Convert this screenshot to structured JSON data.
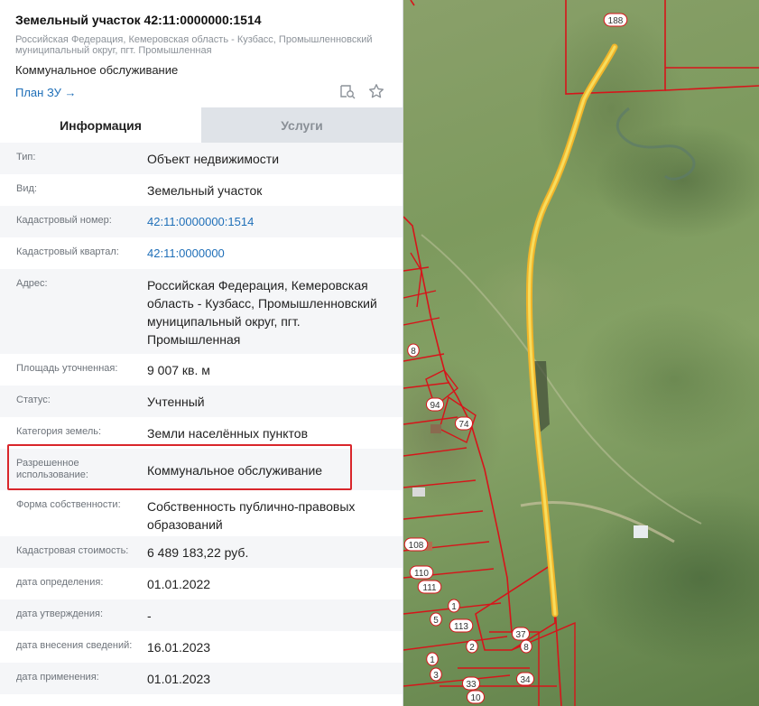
{
  "header": {
    "title": "Земельный участок 42:11:0000000:1514",
    "address_line": "Российская Федерация, Кемеровская область - Кузбасс, Промышленновский муниципальный округ, пгт. Промышленная",
    "purpose": "Коммунальное обслуживание",
    "plan_link": "План ЗУ →"
  },
  "icons": [
    "search-doc-icon",
    "star-icon"
  ],
  "tabs": [
    {
      "label": "Информация",
      "active": true
    },
    {
      "label": "Услуги",
      "active": false
    }
  ],
  "rows": [
    {
      "label": "Тип:",
      "value": "Объект недвижимости"
    },
    {
      "label": "Вид:",
      "value": "Земельный участок"
    },
    {
      "label": "Кадастровый номер:",
      "value": "42:11:0000000:1514"
    },
    {
      "label": "Кадастровый квартал:",
      "value": "42:11:0000000"
    },
    {
      "label": "Адрес:",
      "value": "Российская Федерация, Кемеровская область - Кузбасс, Промышленновский муниципальный округ, пгт. Промышленная"
    },
    {
      "label": "Площадь уточненная:",
      "value": "9 007 кв. м"
    },
    {
      "label": "Статус:",
      "value": "Учтенный"
    },
    {
      "label": "Категория земель:",
      "value": "Земли населённых пунктов"
    },
    {
      "label": "Разрешенное использование:",
      "value": "Коммунальное обслуживание"
    },
    {
      "label": "Форма собственности:",
      "value": "Собственность публично-правовых образований"
    },
    {
      "label": "Кадастровая стоимость:",
      "value": "6 489 183,22 руб."
    },
    {
      "label": "дата определения:",
      "value": "01.01.2022"
    },
    {
      "label": "дата утверждения:",
      "value": "-"
    },
    {
      "label": "дата внесения сведений:",
      "value": "16.01.2023"
    },
    {
      "label": "дата применения:",
      "value": "01.01.2023"
    }
  ],
  "map": {
    "parcel_numbers": [
      "188",
      "8",
      "94",
      "74",
      "108",
      "110",
      "111",
      "113",
      "1",
      "5",
      "2",
      "37",
      "8",
      "33",
      "34",
      "10",
      "1",
      "3"
    ],
    "colors": {
      "parcel_border": "#d7141a",
      "selected_parcel": "#f2c230"
    }
  }
}
